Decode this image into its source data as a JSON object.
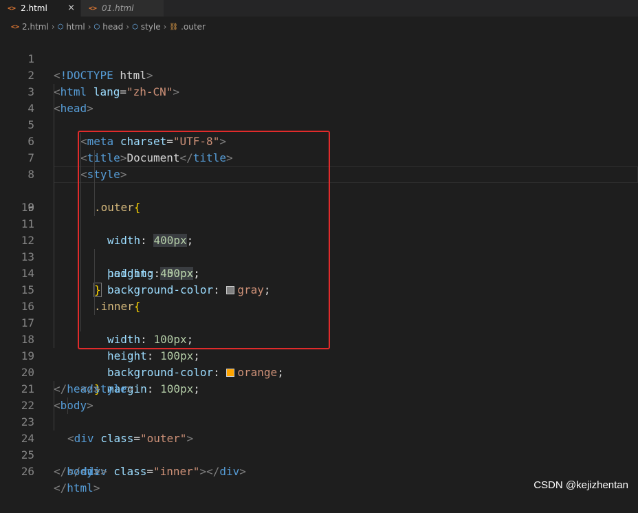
{
  "tabs": [
    {
      "label": "2.html",
      "icon": "html-file-icon",
      "active": true,
      "close": "×"
    },
    {
      "label": "01.html",
      "icon": "html-file-icon",
      "active": false
    }
  ],
  "breadcrumb": {
    "file": "2.html",
    "items": [
      "html",
      "head",
      "style",
      ".outer"
    ]
  },
  "lines": [
    {
      "n": "1"
    },
    {
      "n": "2"
    },
    {
      "n": "3"
    },
    {
      "n": "4"
    },
    {
      "n": "5"
    },
    {
      "n": "6"
    },
    {
      "n": "7"
    },
    {
      "n": "8"
    },
    {
      "n": "9"
    },
    {
      "n": "10"
    },
    {
      "n": "11"
    },
    {
      "n": "12"
    },
    {
      "n": "13"
    },
    {
      "n": "14"
    },
    {
      "n": "15"
    },
    {
      "n": "16"
    },
    {
      "n": "17"
    },
    {
      "n": "18"
    },
    {
      "n": "19"
    },
    {
      "n": "20"
    },
    {
      "n": "21"
    },
    {
      "n": "22"
    },
    {
      "n": "23"
    },
    {
      "n": "24"
    },
    {
      "n": "25"
    },
    {
      "n": "26"
    }
  ],
  "code": {
    "doctype": "!DOCTYPE",
    "html_kw": "html",
    "lang_attr": "lang",
    "lang_val": "\"zh-CN\"",
    "head": "head",
    "meta": "meta",
    "charset": "charset",
    "charset_val": "\"UTF-8\"",
    "title": "title",
    "title_text": "Document",
    "style": "style",
    "outer_sel": ".outer",
    "inner_sel": ".inner",
    "width": "width",
    "height": "height",
    "padding": "padding",
    "bgcolor": "background-color",
    "margin": "margin",
    "v400": "400px",
    "v50": "50px",
    "v100": "100px",
    "gray": "gray",
    "orange": "orange",
    "body": "body",
    "div": "div",
    "class": "class",
    "outer_val": "\"outer\"",
    "inner_val": "\"inner\""
  },
  "colors": {
    "gray_swatch": "#808080",
    "orange_swatch": "#ffa500",
    "highlight_box": "#e12b2b"
  },
  "current_line": "9",
  "watermark": "CSDN @kejizhentan"
}
